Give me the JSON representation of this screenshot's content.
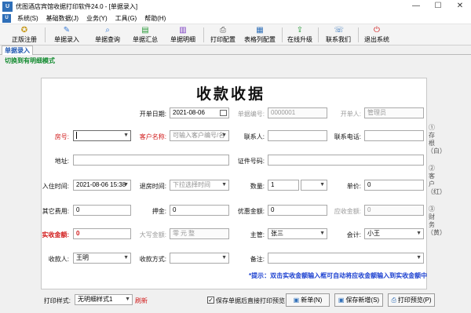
{
  "window": {
    "title": "优图酒店宾馆收据打印软件24.0 - [单据录入]",
    "controls": {
      "minimize": "—",
      "maximize": "☐",
      "close": "✕"
    }
  },
  "menu": [
    "系统(S)",
    "基础数据(J)",
    "业务(Y)",
    "工具(G)",
    "帮助(H)"
  ],
  "toolbar": [
    "正版注册",
    "单据录入",
    "单据查询",
    "单据汇总",
    "单据明细",
    "打印配置",
    "表格列配置",
    "在线升级",
    "联系我们",
    "退出系统"
  ],
  "tab": "单据录入",
  "switch_link": "切换到有明细模式",
  "form": {
    "title": "收款收据",
    "open_date_label": "开单日期:",
    "open_date": "2021-08-06",
    "doc_no_label": "单据编号:",
    "doc_no": "0000001",
    "opener_label": "开单人:",
    "opener": "管理员",
    "room_label": "房号:",
    "customer_label": "客户名称:",
    "customer_placeholder": "可输入客户编号/名",
    "contact_label": "联系人:",
    "phone_label": "联系电话:",
    "address_label": "地址:",
    "id_label": "证件号码:",
    "checkin_label": "入住时间:",
    "checkin": "2021-08-06 15:38",
    "checkout_label": "退房时间:",
    "checkout_placeholder": "下拉选择时间",
    "qty_label": "数量:",
    "qty": "1",
    "price_label": "单价:",
    "price": "0",
    "other_fee_label": "其它费用:",
    "other_fee": "0",
    "deposit_label": "押金:",
    "deposit": "0",
    "discount_label": "优惠金额:",
    "discount": "0",
    "receivable_label": "应收金额:",
    "receivable": "0",
    "actual_label": "实收金额:",
    "actual": "0",
    "capital_label": "大写金额:",
    "capital": "零元整",
    "supervisor_label": "主管:",
    "supervisor": "张三",
    "accountant_label": "会计:",
    "accountant": "小王",
    "payee_label": "收款人:",
    "payee": "王明",
    "pay_method_label": "收款方式:",
    "remark_label": "备注:",
    "hint": "*提示：双击实收金额输入框可自动将应收金额输入到实收金额中"
  },
  "side_links": [
    "①存根（白）",
    "②客户（红）",
    "③财务（黄）"
  ],
  "bottom": {
    "print_style_label": "打印样式:",
    "print_style": "无明细样式1",
    "refresh": "刷新",
    "preview_check_label": "保存单据后直接打印预览",
    "new_btn": "新单(N)",
    "save_new_btn": "保存新增(S)",
    "print_preview_btn": "打印预览(P)"
  }
}
